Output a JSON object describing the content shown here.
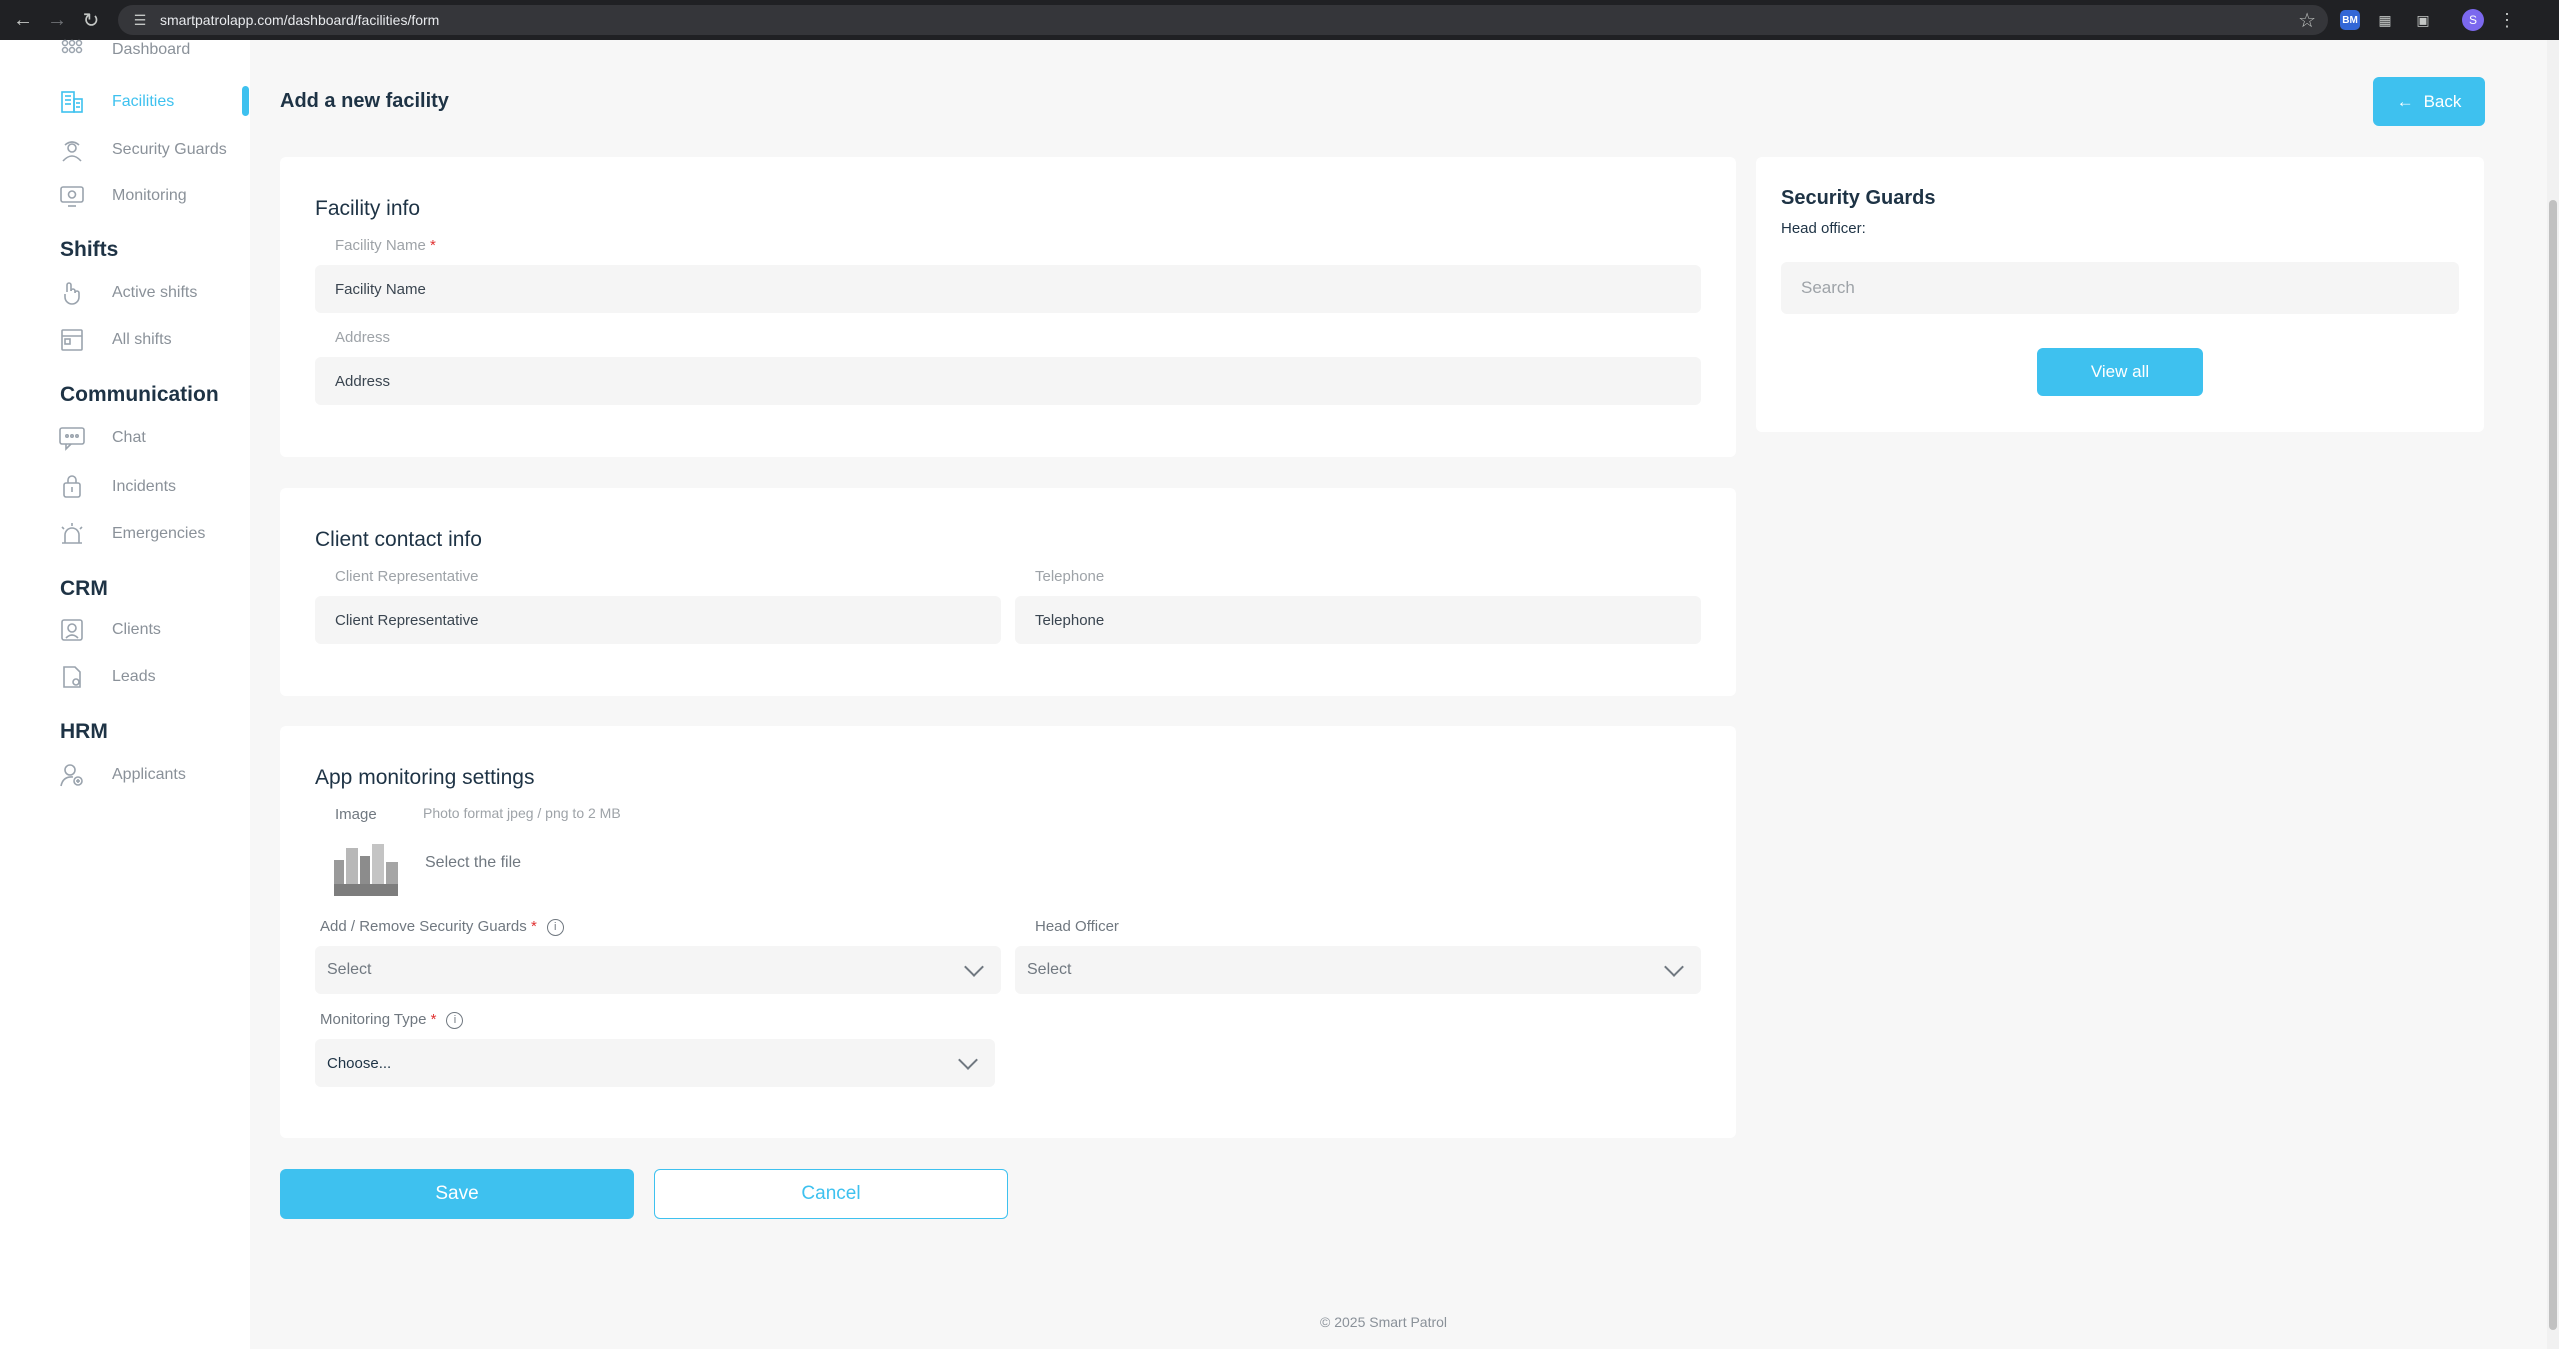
{
  "browser": {
    "url": "smartpatrolapp.com/dashboard/facilities/form",
    "profile_initial": "S",
    "ext_label": "BM"
  },
  "sidebar": {
    "items_top": [
      {
        "label": "Dashboard",
        "icon": "grid-icon"
      },
      {
        "label": "Facilities",
        "icon": "building-icon",
        "active": true
      },
      {
        "label": "Security Guards",
        "icon": "guard-icon"
      },
      {
        "label": "Monitoring",
        "icon": "monitor-icon"
      }
    ],
    "shifts": {
      "title": "Shifts",
      "items": [
        {
          "label": "Active shifts",
          "icon": "hand-icon"
        },
        {
          "label": "All shifts",
          "icon": "calendar-icon"
        }
      ]
    },
    "communication": {
      "title": "Communication",
      "items": [
        {
          "label": "Chat",
          "icon": "chat-icon"
        },
        {
          "label": "Incidents",
          "icon": "incident-icon"
        },
        {
          "label": "Emergencies",
          "icon": "alarm-icon"
        }
      ]
    },
    "crm": {
      "title": "CRM",
      "items": [
        {
          "label": "Clients",
          "icon": "clients-icon"
        },
        {
          "label": "Leads",
          "icon": "leads-icon"
        }
      ]
    },
    "hrm": {
      "title": "HRM",
      "items": [
        {
          "label": "Applicants",
          "icon": "applicant-icon"
        }
      ]
    }
  },
  "header": {
    "title": "Add a new facility",
    "back_label": "Back"
  },
  "facility_info": {
    "title": "Facility info",
    "name_label": "Facility Name",
    "name_placeholder": "Facility Name",
    "address_label": "Address",
    "address_placeholder": "Address"
  },
  "client_contact": {
    "title": "Client contact info",
    "rep_label": "Client Representative",
    "rep_placeholder": "Client Representative",
    "tel_label": "Telephone",
    "tel_placeholder": "Telephone"
  },
  "monitoring": {
    "title": "App monitoring settings",
    "image_label": "Image",
    "image_hint": "Photo format jpeg / png to 2 MB",
    "select_file": "Select the file",
    "guards_label": "Add / Remove Security Guards",
    "guards_value": "Select",
    "head_label": "Head Officer",
    "head_value": "Select",
    "type_label": "Monitoring Type",
    "type_value": "Choose..."
  },
  "guards_panel": {
    "title": "Security Guards",
    "head_officer": "Head officer:",
    "search_placeholder": "Search",
    "view_all": "View all"
  },
  "actions": {
    "save": "Save",
    "cancel": "Cancel"
  },
  "footer": "© 2025 Smart Patrol",
  "colors": {
    "accent": "#3ec1ef",
    "heading": "#1e3345",
    "required": "#e03131"
  }
}
